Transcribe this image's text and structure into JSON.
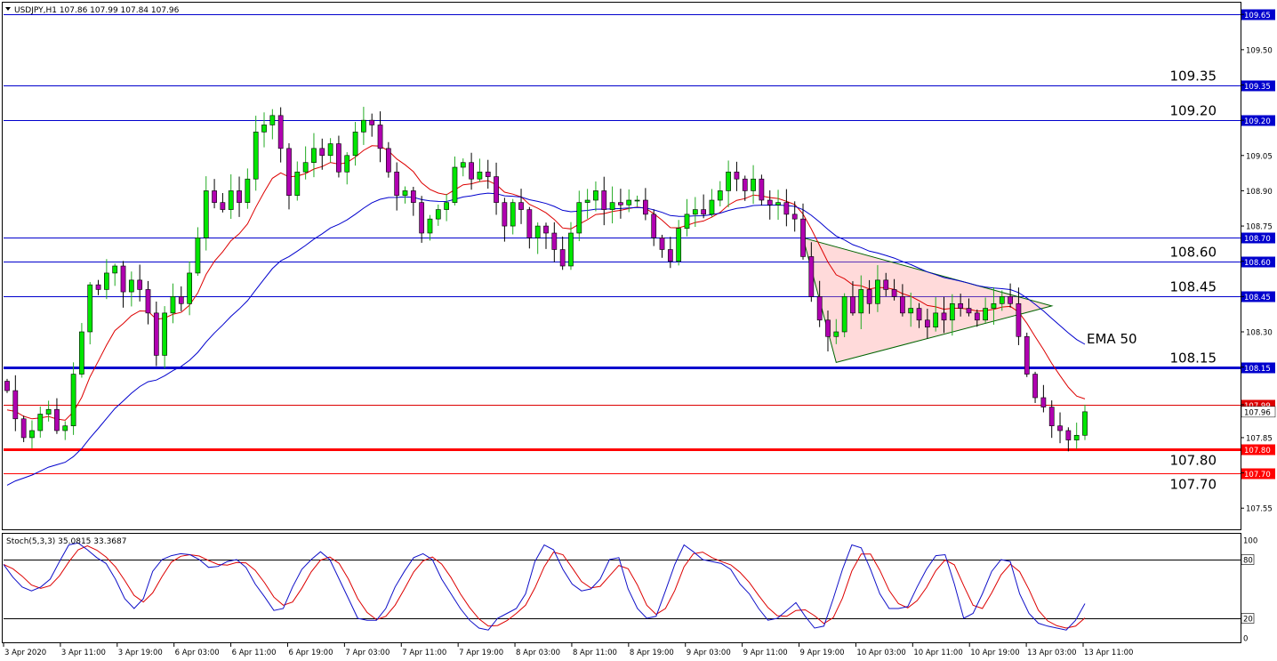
{
  "header": {
    "symbol_caption": "USDJPY,H1  107.86 107.99 107.84 107.96"
  },
  "oscillator": {
    "caption": "Stoch(5,3,3) 35.0815 33.3687",
    "scale_labels": [
      "100",
      "80",
      "20",
      "0"
    ],
    "main_values": [
      75,
      62,
      52,
      48,
      52,
      60,
      78,
      95,
      97,
      90,
      82,
      76,
      60,
      40,
      30,
      40,
      68,
      80,
      84,
      86,
      85,
      80,
      72,
      73,
      78,
      80,
      72,
      55,
      42,
      28,
      30,
      52,
      70,
      80,
      88,
      80,
      60,
      40,
      20,
      18,
      18,
      30,
      52,
      68,
      82,
      86,
      80,
      60,
      45,
      30,
      18,
      10,
      8,
      20,
      25,
      30,
      45,
      78,
      95,
      90,
      70,
      55,
      48,
      50,
      60,
      80,
      82,
      50,
      30,
      20,
      22,
      48,
      75,
      95,
      88,
      80,
      78,
      76,
      70,
      55,
      45,
      30,
      18,
      20,
      28,
      36,
      22,
      10,
      12,
      40,
      70,
      95,
      92,
      70,
      45,
      30,
      30,
      32,
      52,
      70,
      84,
      85,
      55,
      20,
      25,
      45,
      68,
      80,
      78,
      45,
      25,
      15,
      12,
      10,
      8,
      18,
      35
    ]
  },
  "chart_data": {
    "type": "candlestick",
    "symbol": "USDJPY",
    "timeframe": "H1",
    "ohlc_last": {
      "open": 107.86,
      "high": 107.99,
      "low": 107.84,
      "close": 107.96
    },
    "ylim": [
      107.46,
      109.7
    ],
    "y_ticks": [
      109.65,
      109.5,
      109.35,
      109.2,
      109.05,
      108.9,
      108.75,
      108.6,
      108.45,
      108.3,
      108.15,
      107.99,
      107.85,
      107.7,
      107.55
    ],
    "y_tick_labels": [
      "109.65",
      "109.50",
      "109.35",
      "109.20",
      "109.05",
      "108.90",
      "108.75",
      "108.60",
      "108.45",
      "108.30",
      "108.15",
      "107.99",
      "107.85",
      "107.70",
      "107.55"
    ],
    "current_price_label": "107.96",
    "x_labels": [
      "3 Apr 2020",
      "3 Apr 11:00",
      "3 Apr 19:00",
      "6 Apr 03:00",
      "6 Apr 11:00",
      "6 Apr 19:00",
      "7 Apr 03:00",
      "7 Apr 11:00",
      "7 Apr 19:00",
      "8 Apr 03:00",
      "8 Apr 11:00",
      "8 Apr 19:00",
      "9 Apr 03:00",
      "9 Apr 11:00",
      "9 Apr 19:00",
      "10 Apr 03:00",
      "10 Apr 11:00",
      "10 Apr 19:00",
      "13 Apr 03:00",
      "13 Apr 11:00"
    ],
    "levels": [
      {
        "price": 109.65,
        "label": "",
        "axis_label": "109.65",
        "color": "#0000cd",
        "width": 1
      },
      {
        "price": 109.35,
        "label": "109.35",
        "axis_label": "109.35",
        "color": "#0000cd",
        "width": 1
      },
      {
        "price": 109.2,
        "label": "109.20",
        "axis_label": "109.20",
        "color": "#0000cd",
        "width": 1
      },
      {
        "price": 108.7,
        "label": "",
        "axis_label": "108.70",
        "color": "#0000cd",
        "width": 1
      },
      {
        "price": 108.6,
        "label": "108.60",
        "axis_label": "108.60",
        "color": "#0000cd",
        "width": 1
      },
      {
        "price": 108.45,
        "label": "108.45",
        "axis_label": "108.45",
        "color": "#0000cd",
        "width": 1
      },
      {
        "price": 108.15,
        "label": "108.15",
        "axis_label": "108.15",
        "color": "#0000cd",
        "width": 3
      },
      {
        "price": 107.99,
        "label": "",
        "axis_label": "107.99",
        "color": "#dd0000",
        "width": 1
      },
      {
        "price": 107.8,
        "label": "107.80",
        "axis_label": "107.80",
        "color": "#ff0000",
        "width": 3
      },
      {
        "price": 107.7,
        "label": "107.70",
        "axis_label": "107.70",
        "color": "#ff0000",
        "width": 1
      }
    ],
    "ema_label": "EMA 50",
    "closes": [
      108.05,
      107.93,
      107.85,
      107.88,
      107.95,
      107.97,
      107.88,
      107.9,
      108.12,
      108.3,
      108.5,
      108.48,
      108.55,
      108.58,
      108.47,
      108.52,
      108.48,
      108.38,
      108.2,
      108.38,
      108.45,
      108.42,
      108.55,
      108.7,
      108.9,
      108.85,
      108.82,
      108.9,
      108.85,
      108.95,
      109.15,
      109.18,
      109.22,
      109.08,
      108.88,
      108.98,
      109.02,
      109.08,
      109.05,
      109.1,
      108.98,
      109.05,
      109.15,
      109.2,
      109.18,
      109.08,
      108.98,
      108.88,
      108.9,
      108.85,
      108.72,
      108.78,
      108.82,
      108.85,
      109.0,
      109.02,
      108.95,
      108.98,
      108.96,
      108.85,
      108.75,
      108.85,
      108.82,
      108.7,
      108.75,
      108.72,
      108.65,
      108.58,
      108.72,
      108.85,
      108.86,
      108.9,
      108.82,
      108.85,
      108.84,
      108.86,
      108.86,
      108.8,
      108.7,
      108.65,
      108.6,
      108.74,
      108.8,
      108.82,
      108.8,
      108.86,
      108.9,
      108.98,
      108.95,
      108.9,
      108.95,
      108.86,
      108.84,
      108.85,
      108.8,
      108.78,
      108.62,
      108.45,
      108.35,
      108.28,
      108.3,
      108.45,
      108.38,
      108.48,
      108.42,
      108.52,
      108.48,
      108.45,
      108.38,
      108.4,
      108.35,
      108.32,
      108.38,
      108.35,
      108.42,
      108.4,
      108.38,
      108.35,
      108.4,
      108.42,
      108.45,
      108.42,
      108.28,
      108.12,
      108.02,
      107.98,
      107.9,
      107.88,
      107.84,
      107.86,
      107.96
    ],
    "ema_short_start": 107.95,
    "ema_long_start": 107.62,
    "triangle": {
      "points": [
        [
          108.7,
          108.7
        ],
        [
          108.17,
          108.17
        ],
        [
          108.41,
          108.41
        ]
      ],
      "apex_candle_offsets": [
        0,
        4,
        30
      ]
    }
  }
}
